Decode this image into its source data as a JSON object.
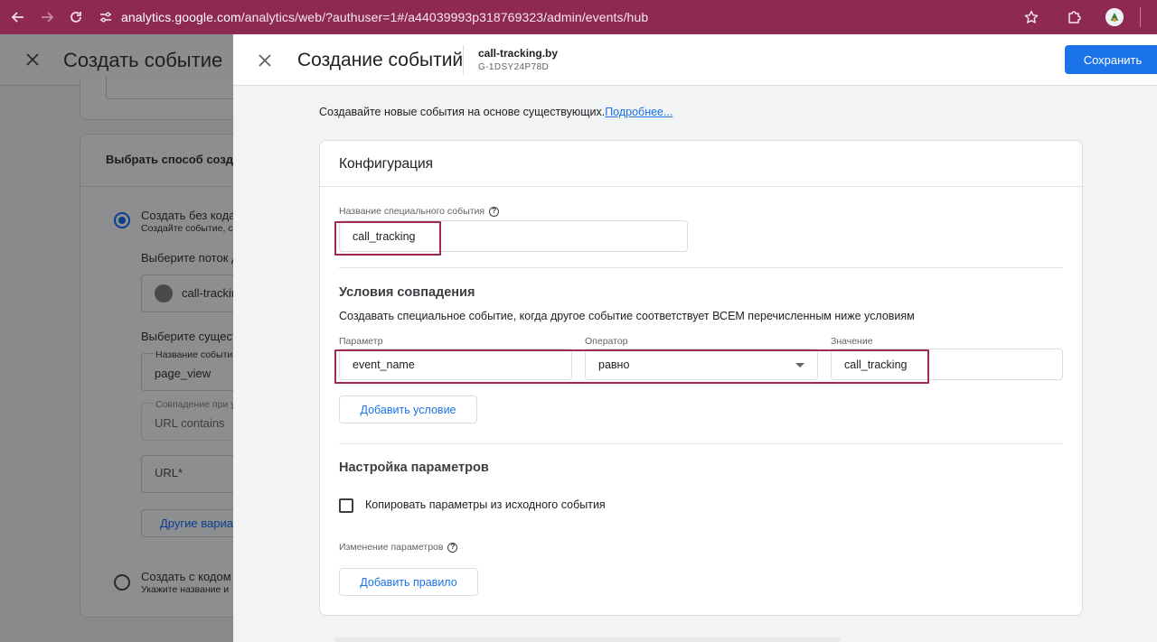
{
  "browser": {
    "url_host": "analytics.google.com",
    "url_path": "/analytics/web/?authuser=1#/a44039993p318769323/admin/events/hub"
  },
  "background_page": {
    "title": "Создать событие",
    "method_title": "Выбрать способ создан",
    "option_no_code_title": "Создать без кода",
    "option_no_code_desc": "Создайте событие, с",
    "choose_stream_label": "Выберите поток д",
    "stream_name": "call-trackin",
    "choose_existing_label": "Выберите сущест",
    "event_name_label": "Название событи",
    "event_name_value": "page_view",
    "match_label": "Совпадение при у",
    "match_value": "URL contains",
    "url_placeholder": "URL*",
    "other_variants_link": "Другие вариа",
    "option_with_code_title": "Создать с кодом",
    "option_with_code_desc": "Укажите название и"
  },
  "panel": {
    "title": "Создание событий",
    "property_name": "call-tracking.by",
    "property_id": "G-1DSY24P78D",
    "save_label": "Сохранить",
    "intro_text": "Создавайте новые события на основе существующих.",
    "intro_link": "Подробнее...",
    "config": {
      "title": "Конфигурация",
      "custom_event_label": "Название специального события",
      "custom_event_value": "call_tracking",
      "conditions": {
        "title": "Условия совпадения",
        "description": "Создавать специальное событие, когда другое событие соответствует ВСЕМ перечисленным ниже условиям",
        "param_label": "Параметр",
        "param_value": "event_name",
        "operator_label": "Оператор",
        "operator_value": "равно",
        "value_label": "Значение",
        "value_value": "call_tracking",
        "add_condition_label": "Добавить условие"
      },
      "params": {
        "title": "Настройка параметров",
        "copy_params_label": "Копировать параметры из исходного события",
        "copy_params_checked": false,
        "modify_label": "Изменение параметров",
        "add_rule_label": "Добавить правило"
      }
    }
  },
  "colors": {
    "browser_bar": "#8e2a52",
    "accent": "#1a73e8",
    "highlight_box": "#9f2b49"
  }
}
